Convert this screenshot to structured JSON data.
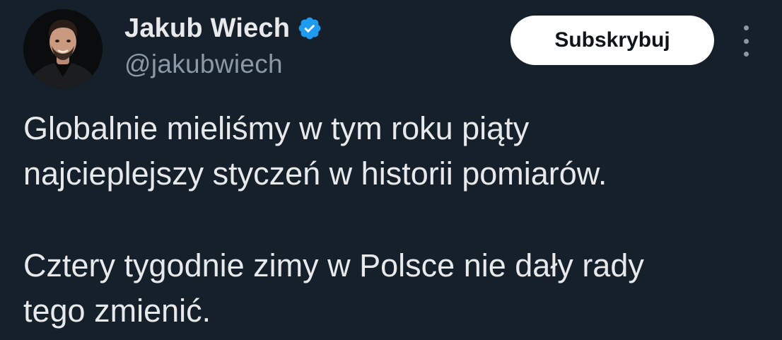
{
  "author": {
    "display_name": "Jakub Wiech",
    "handle": "@jakubwiech",
    "verified": true,
    "verified_icon": "verified-badge-icon",
    "verified_color": "#1d9bf0"
  },
  "actions": {
    "subscribe_label": "Subskrybuj",
    "more_icon": "more-vertical-icon"
  },
  "tweet": {
    "paragraphs": [
      {
        "lines": [
          "Globalnie mieliśmy w tym roku piąty",
          "najcieplejszy styczeń w historii pomiarów."
        ]
      },
      {
        "lines": [
          "Cztery tygodnie zimy w Polsce nie dały rady",
          "tego zmienić."
        ]
      }
    ]
  },
  "colors": {
    "background": "#15202b",
    "text": "#e7e9ea",
    "secondary_text": "#8b98a5",
    "button_background": "#ffffff",
    "button_text": "#0f1419"
  }
}
